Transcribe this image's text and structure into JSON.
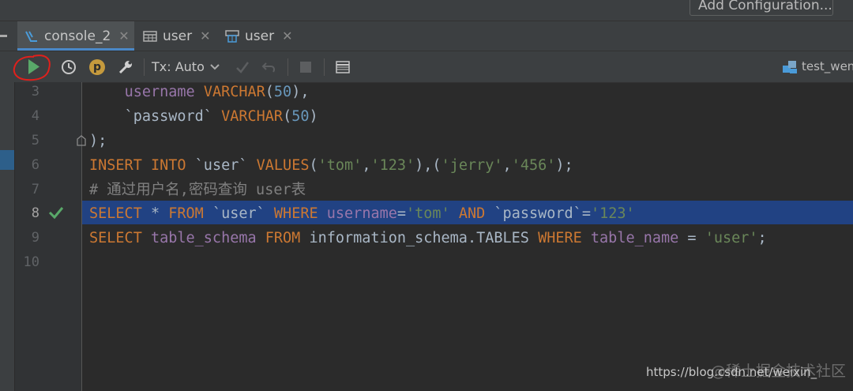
{
  "top": {
    "add_config_label": "Add Configuration..."
  },
  "tabs": [
    {
      "label": "console_2",
      "icon": "console-icon"
    },
    {
      "label": "user",
      "icon": "table-icon"
    },
    {
      "label": "user",
      "icon": "table-schema-icon"
    }
  ],
  "tab_close": "✕",
  "toolbar": {
    "tx_label": "Tx: Auto",
    "p_badge": "p",
    "db_label": "test_wens"
  },
  "editor": {
    "line_numbers": [
      "3",
      "4",
      "5",
      "6",
      "7",
      "8",
      "9",
      "10"
    ],
    "lines": [
      "    username VARCHAR(50),",
      "    `password` VARCHAR(50)",
      ");",
      "INSERT INTO `user` VALUES('tom','123'),('jerry','456');",
      "# 通过用户名,密码查询 user表",
      "SELECT * FROM `user` WHERE username='tom' AND `password`='123'",
      "SELECT table_schema FROM information_schema.TABLES WHERE table_name = 'user';",
      ""
    ]
  },
  "colors": {
    "accent": "#4a88c7",
    "keyword": "#cc7832",
    "string": "#6a8759",
    "number": "#6897bb",
    "selection": "#214283",
    "run_green": "#59a869",
    "annotation_red": "#e0201c"
  },
  "watermark": {
    "url": "https://blog.csdn.net/weixin_",
    "site": "@稀土掘金技术社区"
  }
}
